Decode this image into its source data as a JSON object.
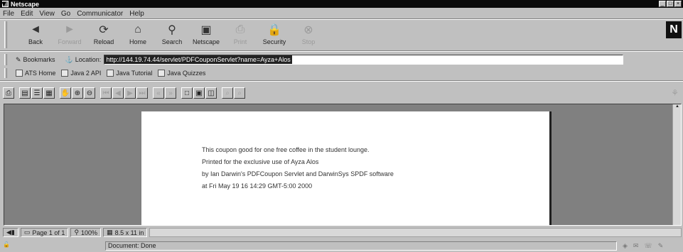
{
  "window": {
    "title": "Netscape"
  },
  "menu": [
    "File",
    "Edit",
    "View",
    "Go",
    "Communicator",
    "Help"
  ],
  "nav_buttons": [
    {
      "label": "Back",
      "icon": "back-arrow-icon",
      "glyph": "◄",
      "enabled": true
    },
    {
      "label": "Forward",
      "icon": "forward-arrow-icon",
      "glyph": "►",
      "enabled": false
    },
    {
      "label": "Reload",
      "icon": "reload-icon",
      "glyph": "⟳",
      "enabled": true
    },
    {
      "label": "Home",
      "icon": "home-icon",
      "glyph": "⌂",
      "enabled": true
    },
    {
      "label": "Search",
      "icon": "search-icon",
      "glyph": "⚲",
      "enabled": true
    },
    {
      "label": "Netscape",
      "icon": "netscape-icon",
      "glyph": "▣",
      "enabled": true
    },
    {
      "label": "Print",
      "icon": "print-icon",
      "glyph": "⎙",
      "enabled": false
    },
    {
      "label": "Security",
      "icon": "lock-icon",
      "glyph": "🔒",
      "enabled": true
    },
    {
      "label": "Stop",
      "icon": "stop-icon",
      "glyph": "⊗",
      "enabled": false
    }
  ],
  "location": {
    "bookmarks_label": "Bookmarks",
    "location_label": "Location:",
    "url": "http://144.19.74.44/servlet/PDFCouponServlet?name=Ayza+Alos"
  },
  "personal_toolbar": [
    "ATS Home",
    "Java 2 API",
    "Java Tutorial",
    "Java Quizzes"
  ],
  "pdf_toolbar": [
    "print",
    "page-only",
    "bookmarks",
    "thumbnails",
    "hand",
    "zoom-in",
    "zoom-out",
    "first-page",
    "prev-page",
    "next-page",
    "last-page",
    "go-back",
    "go-forward",
    "actual-size",
    "fit-page",
    "fit-width",
    "find",
    "find-next"
  ],
  "document": {
    "lines": [
      "This coupon good for one free coffee in the student lounge.",
      "Printed for the exclusive use of Ayza Alos",
      "by Ian Darwin's PDFCoupon Servlet and DarwinSys SPDF software",
      "at Fri May 19 16 14:29 GMT-5:00 2000"
    ]
  },
  "viewer_status": {
    "page": "Page 1 of 1",
    "zoom": "100%",
    "page_size": "8.5 x 11 in"
  },
  "statusbar": {
    "message": "Document: Done"
  },
  "colors": {
    "window_bg": "#c0c0c0",
    "titlebar": "#0a0a0a",
    "viewer_bg": "#808080"
  }
}
